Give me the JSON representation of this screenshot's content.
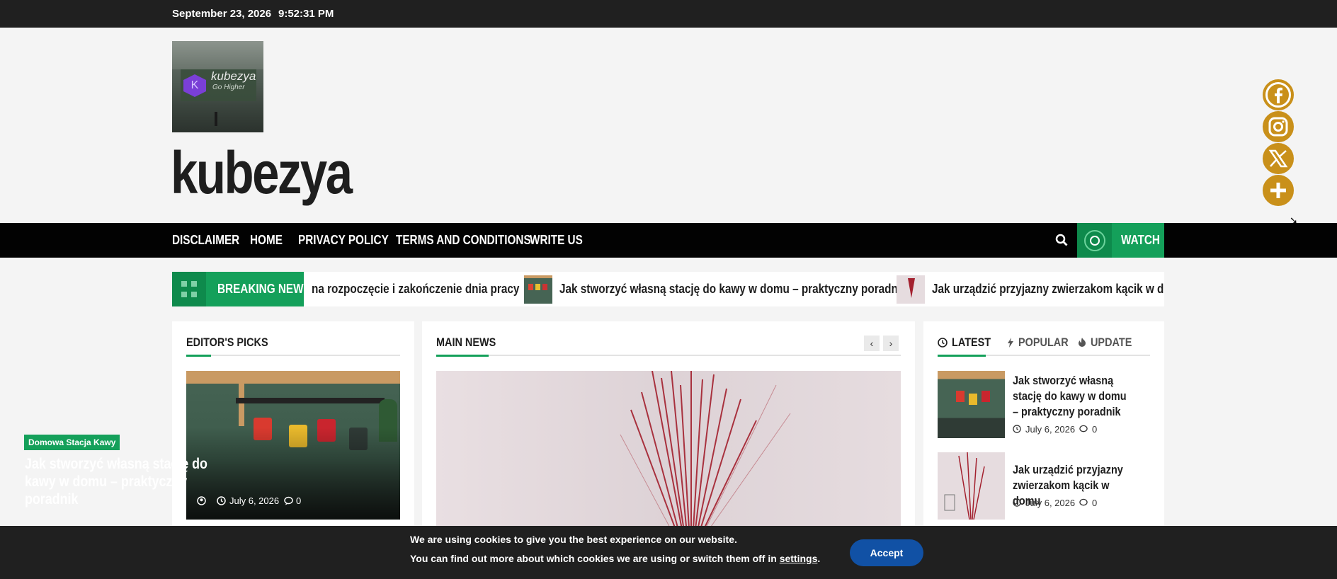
{
  "topbar": {
    "date": "September 23, 2026",
    "time": "9:52:31 PM"
  },
  "header": {
    "logo_name": "kubezya",
    "logo_tagline": "Go Higher",
    "logo_mark": "K",
    "site_title": "kubezya"
  },
  "social": [
    "facebook-icon",
    "instagram-icon",
    "x-icon",
    "plus-icon"
  ],
  "nav": {
    "items": [
      "DISCLAIMER",
      "HOME",
      "PRIVACY POLICY",
      "TERMS AND CONDITIONS",
      "WRITE US"
    ],
    "watch_label": "WATCH"
  },
  "breaking": {
    "label": "BREAKING NEWS",
    "items": [
      "na rozpoczęcie i zakończenie dnia pracy",
      "Jak stworzyć własną stację do kawy w domu – praktyczny poradnik",
      "Jak urządzić przyjazny zwierzakom kącik w domu"
    ]
  },
  "editors_picks": {
    "heading": "EDITOR'S PICKS",
    "category": "Domowa Stacja Kawy",
    "title": "Jak stworzyć własną stację do kawy w domu – praktyczny poradnik",
    "date": "July 6, 2026",
    "comments": "0"
  },
  "main_news": {
    "heading": "MAIN NEWS"
  },
  "tabs": {
    "latest": "LATEST",
    "popular": "POPULAR",
    "update": "UPDATE"
  },
  "latest": [
    {
      "title": "Jak stworzyć własną stację do kawy w domu – praktyczny poradnik",
      "date": "July 6, 2026",
      "comments": "0"
    },
    {
      "title": "Jak urządzić przyjazny zwierzakom kącik w domu",
      "date": "July 6, 2026",
      "comments": "0"
    }
  ],
  "cookie": {
    "line1": "We are using cookies to give you the best experience on our website.",
    "line2_prefix": "You can find out more about which cookies we are using or switch them off in",
    "line2_link": "settings",
    "line2_suffix": ".",
    "accept": "Accept"
  },
  "colors": {
    "accent": "#14a05a",
    "social": "#c9901a",
    "accept": "#1151a5"
  }
}
